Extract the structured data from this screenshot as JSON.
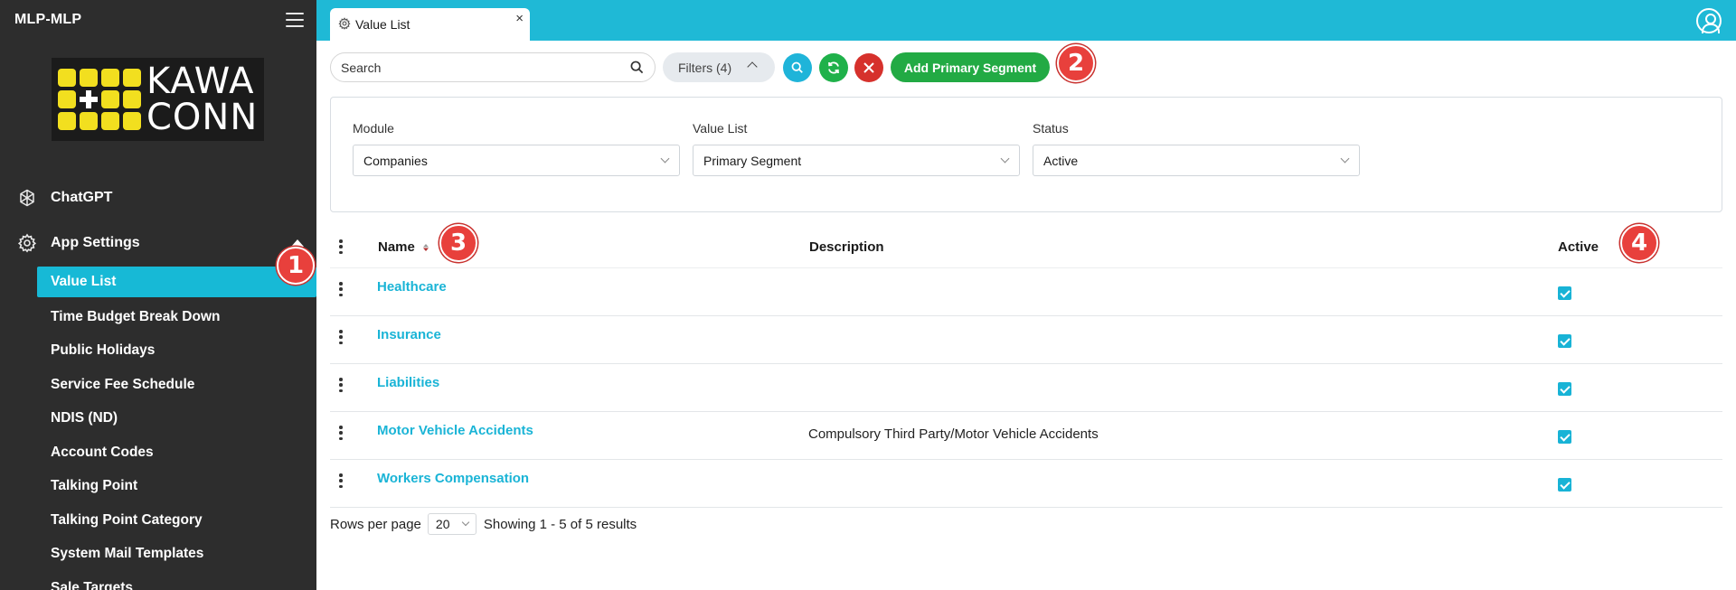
{
  "app": {
    "title": "MLP-MLP"
  },
  "logo": {
    "line1": "KAWA",
    "line2": "CONN"
  },
  "sidebar": {
    "top_items": [
      {
        "label": "ChatGPT",
        "icon": "openai-icon"
      },
      {
        "label": "App Settings",
        "icon": "gear-icon",
        "expanded": true
      }
    ],
    "sub_items": [
      {
        "label": "Value List",
        "active": true
      },
      {
        "label": "Time Budget Break Down"
      },
      {
        "label": "Public Holidays"
      },
      {
        "label": "Service Fee Schedule"
      },
      {
        "label": "NDIS (ND)"
      },
      {
        "label": "Account Codes"
      },
      {
        "label": "Talking Point"
      },
      {
        "label": "Talking Point Category"
      },
      {
        "label": "System Mail Templates"
      },
      {
        "label": "Sale Targets"
      }
    ]
  },
  "tab": {
    "label": "Value List",
    "icon": "gear-icon",
    "close": "×"
  },
  "toolbar": {
    "search_placeholder": "Search",
    "filters_label": "Filters (4)",
    "add_label": "Add Primary Segment"
  },
  "filters": {
    "module": {
      "label": "Module",
      "value": "Companies"
    },
    "value_list": {
      "label": "Value List",
      "value": "Primary Segment"
    },
    "status": {
      "label": "Status",
      "value": "Active"
    }
  },
  "table": {
    "columns": {
      "name": "Name",
      "description": "Description",
      "active": "Active"
    },
    "rows": [
      {
        "name": "Healthcare",
        "description": "",
        "active": true
      },
      {
        "name": "Insurance",
        "description": "",
        "active": true
      },
      {
        "name": "Liabilities",
        "description": "",
        "active": true
      },
      {
        "name": "Motor Vehicle Accidents",
        "description": "Compulsory Third Party/Motor Vehicle Accidents",
        "active": true
      },
      {
        "name": "Workers Compensation",
        "description": "",
        "active": true
      }
    ]
  },
  "footer": {
    "rows_per_page_label": "Rows per page",
    "rows_per_page": "20",
    "showing": "Showing 1 - 5 of 5 results"
  },
  "badges": [
    "1",
    "2",
    "3",
    "4"
  ],
  "colors": {
    "accent": "#1fb9d6",
    "sidebar": "#2d2d2d",
    "add": "#22aa44",
    "danger": "#d6312c",
    "badge": "#e8403c"
  }
}
